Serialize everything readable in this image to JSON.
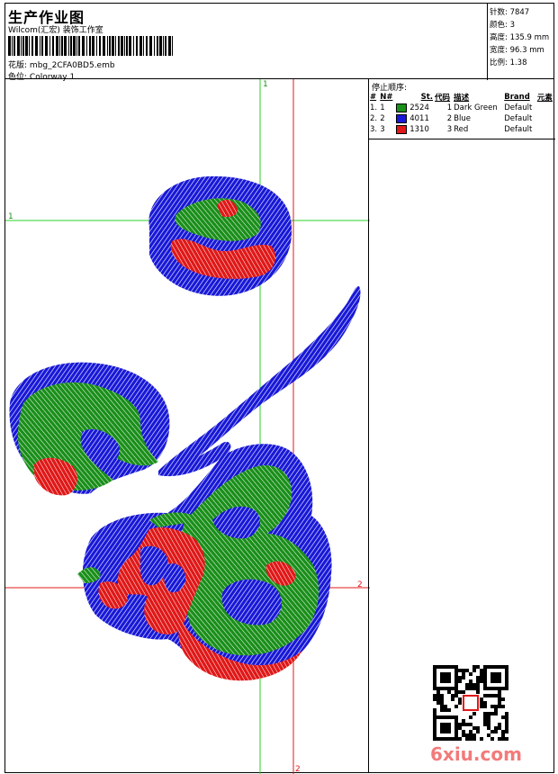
{
  "header": {
    "title": "生产作业图",
    "studio": "Wilcom(汇宏) 装饰工作室",
    "design_label": "花版:",
    "design_file": "mbg_2CFA0BD5.emb",
    "colorway_label": "色位:",
    "colorway": "Colorway 1"
  },
  "stats": {
    "stitches": "针数: 7847",
    "colors": "颜色: 3",
    "height": "高度: 135.9 mm",
    "width": "宽度: 96.3 mm",
    "scale": "比例: 1.38"
  },
  "stop_sequence": {
    "title": "停止顺序:",
    "headers": [
      "#",
      "N#",
      "St.",
      "代码",
      "描述",
      "Brand",
      "元素"
    ],
    "rows": [
      {
        "num": "1.",
        "needle": "1",
        "stitches": "2524",
        "code": "1",
        "desc": "Dark Green",
        "brand": "Default",
        "color": "#1a8f1a"
      },
      {
        "num": "2.",
        "needle": "2",
        "stitches": "4011",
        "code": "2",
        "desc": "Blue",
        "brand": "Default",
        "color": "#1818d8"
      },
      {
        "num": "3.",
        "needle": "3",
        "stitches": "1310",
        "code": "3",
        "desc": "Red",
        "brand": "Default",
        "color": "#e01818"
      }
    ]
  },
  "guides": {
    "label_1a": "1",
    "label_1b": "1",
    "label_2a": "2",
    "label_2b": "2"
  },
  "colors": {
    "green": "#1a8f1a",
    "blue": "#1818d8",
    "red": "#e01818",
    "guide_green": "#2ad12a",
    "guide_red": "#e01818"
  },
  "watermark": {
    "logo": "6xiu.com",
    "qr_icon": "qr-code-icon"
  }
}
